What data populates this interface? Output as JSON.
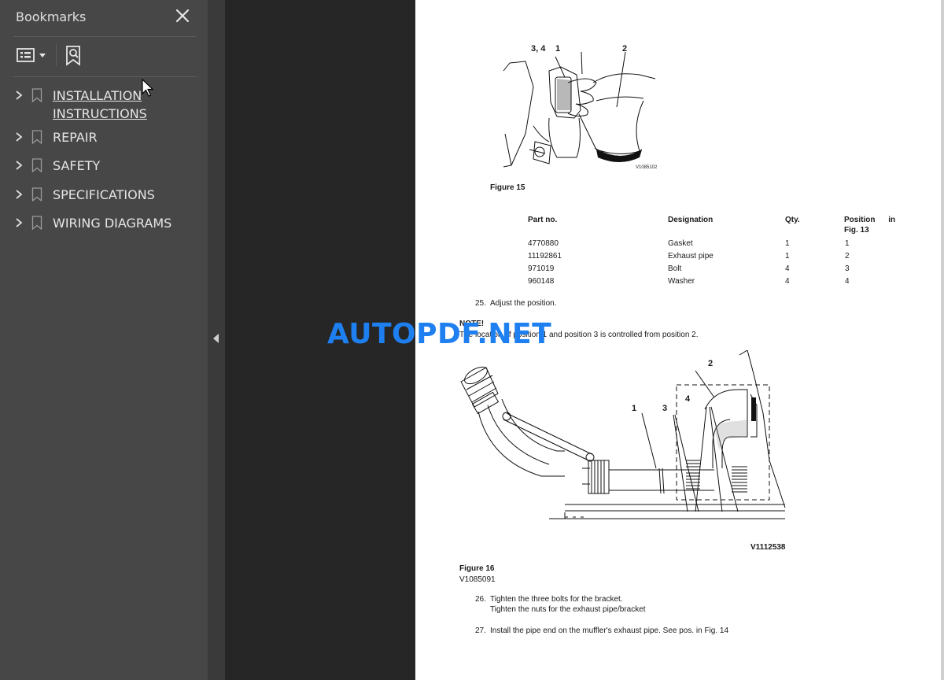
{
  "sidebar": {
    "title": "Bookmarks",
    "items": [
      {
        "label": "INSTALLATION\nINSTRUCTIONS"
      },
      {
        "label": "REPAIR"
      },
      {
        "label": "SAFETY"
      },
      {
        "label": "SPECIFICATIONS"
      },
      {
        "label": "WIRING DIAGRAMS"
      }
    ]
  },
  "document": {
    "figure15": {
      "callouts": [
        "3, 4",
        "1",
        "2"
      ],
      "image_code": "V1085102",
      "caption": "Figure 15"
    },
    "table": {
      "headers": [
        "Part no.",
        "Designation",
        "Qty.",
        "Position in",
        "Fig. 13"
      ],
      "rows": [
        [
          "4770880",
          "Gasket",
          "1",
          "1"
        ],
        [
          "11192861",
          "Exhaust pipe",
          "1",
          "2"
        ],
        [
          "971019",
          "Bolt",
          "4",
          "3"
        ],
        [
          "960148",
          "Washer",
          "4",
          "4"
        ]
      ]
    },
    "step25": {
      "num": "25.",
      "text": "Adjust the position."
    },
    "note": {
      "label": "NOTE!",
      "text": "The location of position 1 and position 3 is controlled from position 2."
    },
    "figure16": {
      "callouts": [
        "1",
        "2",
        "3",
        "4"
      ],
      "image_code": "V1112538",
      "caption": "Figure 16",
      "subcaption": "V1085091"
    },
    "step26": {
      "num": "26.",
      "line1": "Tighten the three bolts for the bracket.",
      "line2": "Tighten the nuts for the exhaust pipe/bracket"
    },
    "step27": {
      "num": "27.",
      "text": "Install the pipe end on the muffler's exhaust pipe. See pos. in Fig. 14"
    }
  },
  "watermark": "AUTOPDF.NET"
}
